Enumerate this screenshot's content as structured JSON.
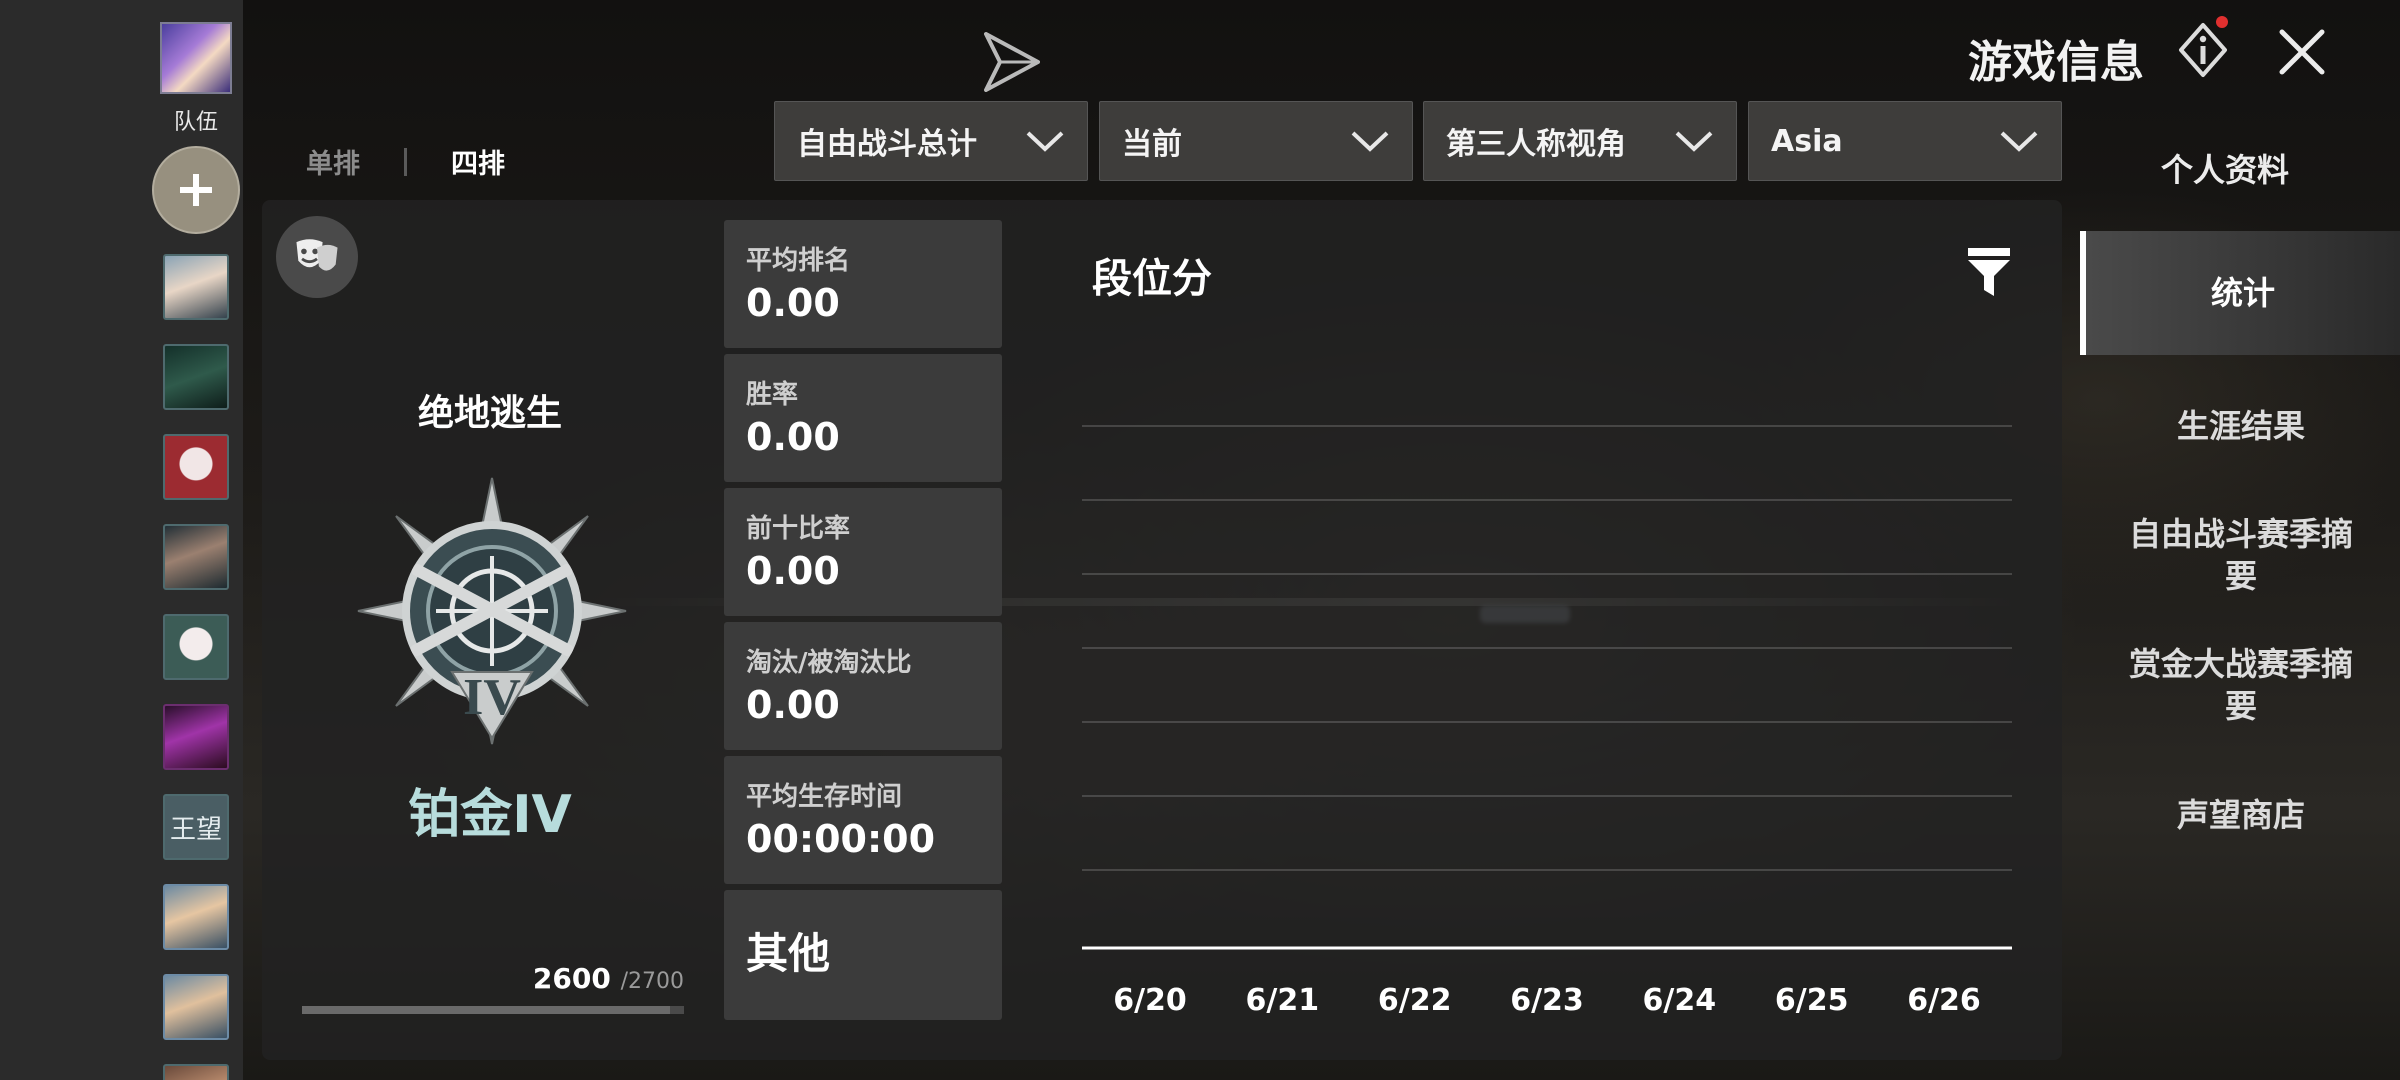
{
  "header": {
    "title": "游戏信息",
    "info_icon": "info-icon",
    "close_icon": "close-icon",
    "share_icon": "paper-plane-icon",
    "notification_dot_color": "#e0302f"
  },
  "friends": {
    "team_label": "队伍",
    "add_icon": "plus-icon",
    "avatars": [
      "",
      "",
      "",
      "",
      "",
      "",
      "王望",
      "",
      "",
      ""
    ]
  },
  "mode_tabs": {
    "solo": "单排",
    "squad": "四排",
    "active": "四排"
  },
  "filters": {
    "mode": "自由战斗总计",
    "season": "当前",
    "perspective": "第三人称视角",
    "region": "Asia"
  },
  "nav": {
    "profile": "个人资料",
    "items": [
      {
        "label": "统计",
        "active": true
      },
      {
        "label": "生涯结果",
        "active": false
      },
      {
        "label": "自由战斗赛季摘要",
        "active": false
      },
      {
        "label": "赏金大战赛季摘要",
        "active": false
      },
      {
        "label": "声望商店",
        "active": false
      }
    ]
  },
  "rank": {
    "mode_name": "绝地逃生",
    "tier": "铂金IV",
    "points": "2600",
    "max_points": "/2700",
    "progress": 0.963,
    "mask_icon": "theater-mask-icon",
    "badge_icon": "rank-badge-icon",
    "tier_color": "#b7dcdc"
  },
  "stats": [
    {
      "label": "平均排名",
      "value": "0.00"
    },
    {
      "label": "胜率",
      "value": "0.00"
    },
    {
      "label": "前十比率",
      "value": "0.00"
    },
    {
      "label": "淘汰/被淘汰比",
      "value": "0.00"
    },
    {
      "label": "平均生存时间",
      "value": "00:00:00"
    }
  ],
  "other_label": "其他",
  "chart_title": "段位分",
  "filter_icon": "filter-icon",
  "chart_data": {
    "type": "line",
    "title": "段位分",
    "categories": [
      "6/20",
      "6/21",
      "6/22",
      "6/23",
      "6/24",
      "6/25",
      "6/26"
    ],
    "series": [],
    "grid": true,
    "xlabel": "",
    "ylabel": ""
  }
}
